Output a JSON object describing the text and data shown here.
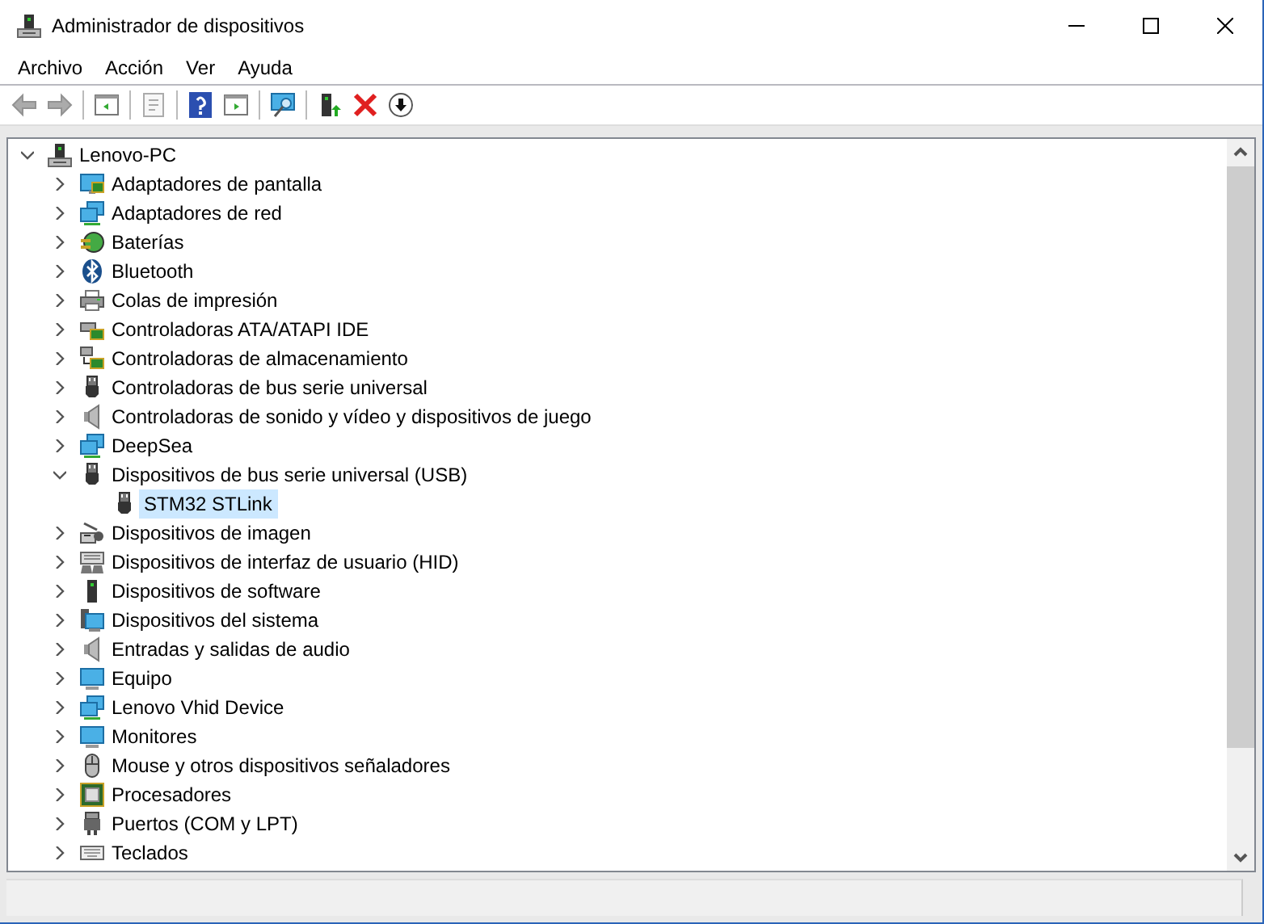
{
  "window": {
    "title": "Administrador de dispositivos"
  },
  "menu": [
    {
      "label": "Archivo"
    },
    {
      "label": "Acción"
    },
    {
      "label": "Ver"
    },
    {
      "label": "Ayuda"
    }
  ],
  "toolbar": [
    {
      "kind": "back",
      "disabled": true
    },
    {
      "kind": "forward",
      "disabled": true
    },
    {
      "kind": "sep"
    },
    {
      "kind": "pane",
      "disabled": false
    },
    {
      "kind": "sep"
    },
    {
      "kind": "properties",
      "disabled": true
    },
    {
      "kind": "sep"
    },
    {
      "kind": "help",
      "disabled": false
    },
    {
      "kind": "pane2",
      "disabled": false
    },
    {
      "kind": "sep"
    },
    {
      "kind": "scan",
      "disabled": false
    },
    {
      "kind": "sep"
    },
    {
      "kind": "update",
      "disabled": false
    },
    {
      "kind": "remove",
      "disabled": false
    },
    {
      "kind": "download",
      "disabled": false
    }
  ],
  "tree": [
    {
      "label": "Lenovo-PC",
      "expanded": true,
      "selected": false,
      "children": [
        {
          "label": "Adaptadores de pantalla",
          "expanded": false,
          "selected": false
        },
        {
          "label": "Adaptadores de red",
          "expanded": false,
          "selected": false
        },
        {
          "label": "Baterías",
          "expanded": false,
          "selected": false
        },
        {
          "label": "Bluetooth",
          "expanded": false,
          "selected": false
        },
        {
          "label": "Colas de impresión",
          "expanded": false,
          "selected": false
        },
        {
          "label": "Controladoras ATA/ATAPI IDE",
          "expanded": false,
          "selected": false
        },
        {
          "label": "Controladoras de almacenamiento",
          "expanded": false,
          "selected": false
        },
        {
          "label": "Controladoras de bus serie universal",
          "expanded": false,
          "selected": false
        },
        {
          "label": "Controladoras de sonido y vídeo y dispositivos de juego",
          "expanded": false,
          "selected": false
        },
        {
          "label": "DeepSea",
          "expanded": false,
          "selected": false
        },
        {
          "label": "Dispositivos de bus serie universal (USB)",
          "expanded": true,
          "selected": false,
          "children": [
            {
              "label": "STM32 STLink",
              "selected": true
            }
          ]
        },
        {
          "label": "Dispositivos de imagen",
          "expanded": false,
          "selected": false
        },
        {
          "label": "Dispositivos de interfaz de usuario (HID)",
          "expanded": false,
          "selected": false
        },
        {
          "label": "Dispositivos de software",
          "expanded": false,
          "selected": false
        },
        {
          "label": "Dispositivos del sistema",
          "expanded": false,
          "selected": false
        },
        {
          "label": "Entradas y salidas de audio",
          "expanded": false,
          "selected": false
        },
        {
          "label": "Equipo",
          "expanded": false,
          "selected": false
        },
        {
          "label": "Lenovo Vhid Device",
          "expanded": false,
          "selected": false
        },
        {
          "label": "Monitores",
          "expanded": false,
          "selected": false
        },
        {
          "label": "Mouse y otros dispositivos señaladores",
          "expanded": false,
          "selected": false
        },
        {
          "label": "Procesadores",
          "expanded": false,
          "selected": false
        },
        {
          "label": "Puertos (COM y LPT)",
          "expanded": false,
          "selected": false
        },
        {
          "label": "Teclados",
          "expanded": false,
          "selected": false
        }
      ]
    }
  ]
}
